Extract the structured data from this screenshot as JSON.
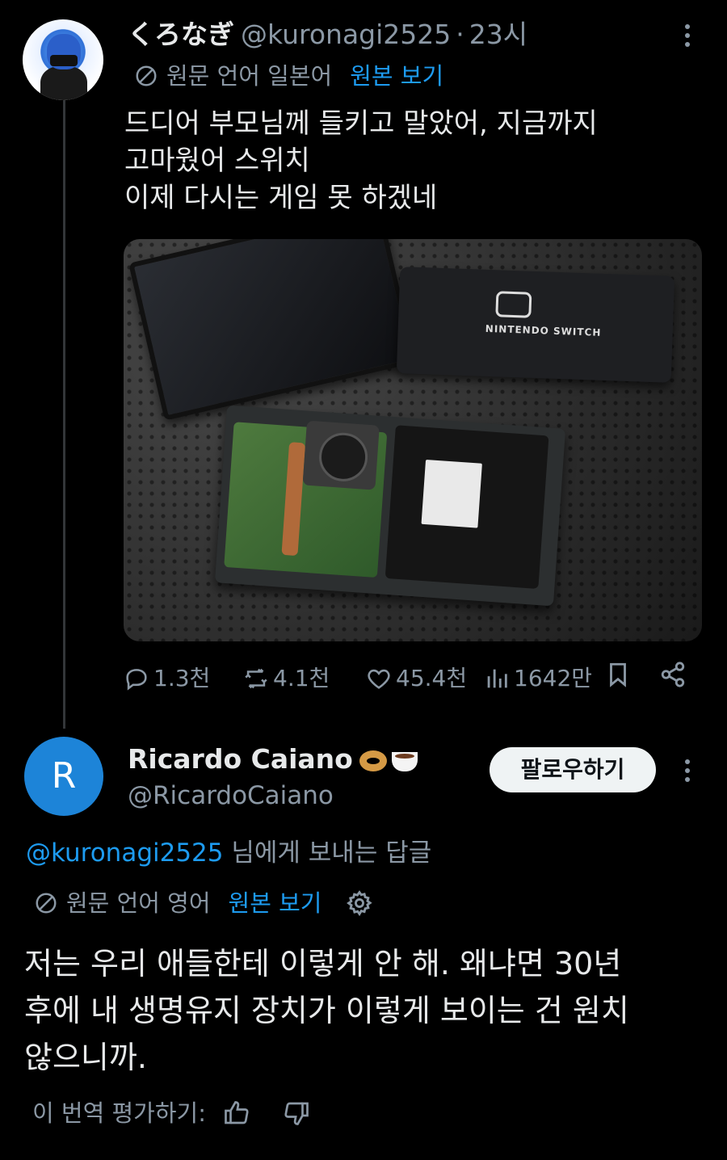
{
  "tweet": {
    "display_name": "くろなぎ",
    "handle": "@kuronagi2525",
    "separator": "·",
    "time": "23시",
    "translation_note": "원문 언어 일본어",
    "show_original": "원본 보기",
    "text_lines": [
      "드디어 부모님께 들키고 말았어, 지금까지",
      "고마웠어 스위치",
      "이제 다시는 게임 못 하겠네"
    ],
    "photo_brand_text": "NINTENDO SWITCH",
    "stats": {
      "replies": "1.3천",
      "reposts": "4.1천",
      "likes": "45.4천",
      "views": "1642만"
    }
  },
  "reply": {
    "avatar_letter": "R",
    "display_name": "Ricardo Caiano",
    "handle": "@RicardoCaiano",
    "follow_label": "팔로우하기",
    "replying_mention": "@kuronagi2525",
    "replying_suffix": " 님에게 보내는 답글",
    "translation_note": "원문 언어 영어",
    "show_original": "원본 보기",
    "text_lines": [
      "저는 우리 애들한테 이렇게 안 해. 왜냐면 30년",
      "후에 내 생명유지 장치가 이렇게 보이는 건 원치",
      "않으니까."
    ],
    "rate_label": "이 번역 평가하기:"
  },
  "colors": {
    "background": "#000000",
    "text": "#e7e9ea",
    "muted": "#8b98a5",
    "link": "#1d9bf0",
    "avatar_reply": "#1d84d8"
  }
}
